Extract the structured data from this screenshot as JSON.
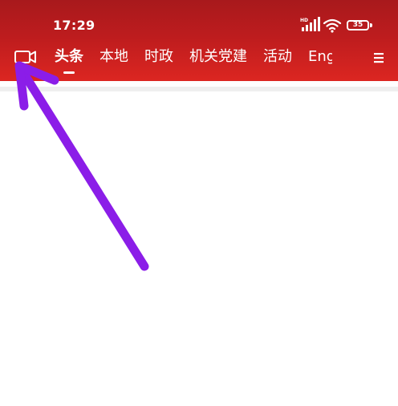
{
  "status_bar": {
    "time": "17:29",
    "battery": "35",
    "signal_label": "HD"
  },
  "nav": {
    "video_icon": "video-camera-icon",
    "menu_icon": "menu-icon",
    "tabs": [
      {
        "label": "头条",
        "active": true
      },
      {
        "label": "本地"
      },
      {
        "label": "时政"
      },
      {
        "label": "机关党建"
      },
      {
        "label": "活动"
      },
      {
        "label": "Eng"
      }
    ]
  },
  "colors": {
    "header_red": "#d32420",
    "arrow_purple": "#8b1de8",
    "divider_gray": "#efefef"
  }
}
